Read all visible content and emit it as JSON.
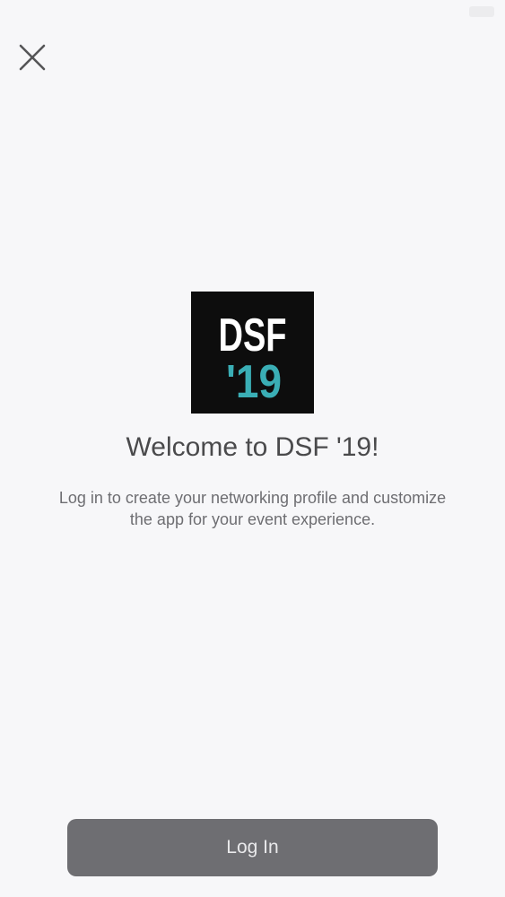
{
  "logo": {
    "line1": "DSF",
    "line2": "'19",
    "line1_color": "#ffffff",
    "line2_color": "#3aaeb5",
    "background": "#0d0d0d"
  },
  "welcome": {
    "title": "Welcome to DSF '19!",
    "subtitle": "Log in to create your networking profile and customize the app for your event experience."
  },
  "actions": {
    "login_label": "Log In"
  },
  "icons": {
    "close": "close-icon",
    "battery": "battery-icon"
  },
  "colors": {
    "background": "#f7f7f9",
    "button": "#6e6e72",
    "button_text": "#e9e9eb",
    "title_text": "#4a4a4c",
    "body_text": "#6e6e72"
  }
}
